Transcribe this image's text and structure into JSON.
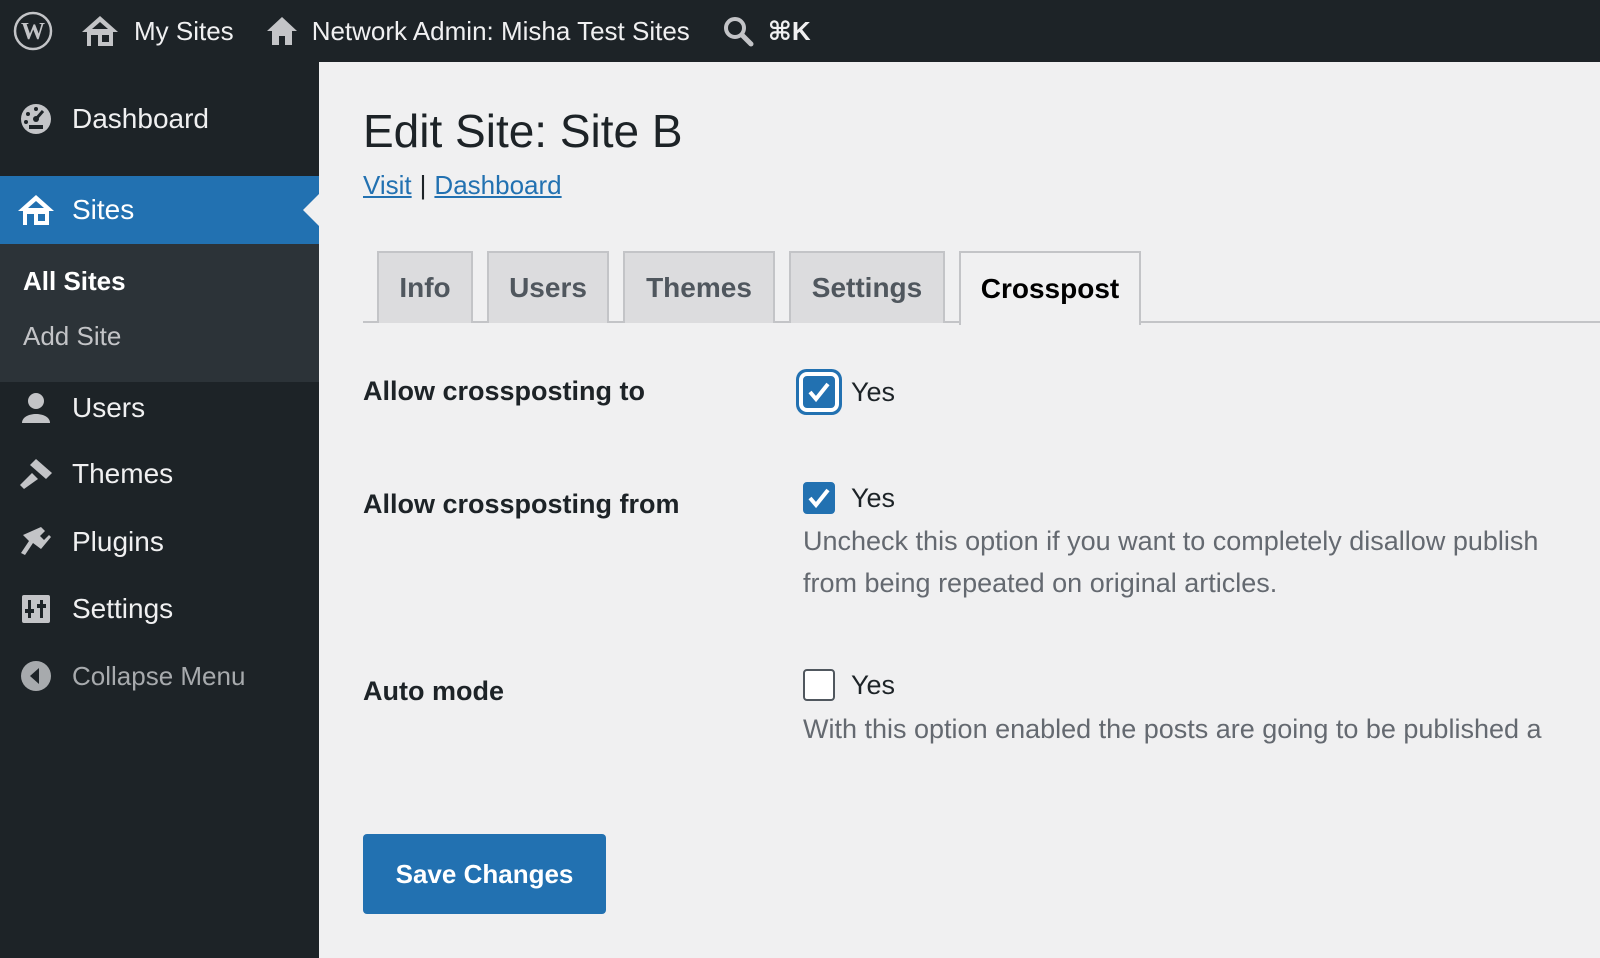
{
  "adminbar": {
    "my_sites": "My Sites",
    "network_admin": "Network Admin: Misha Test Sites",
    "shortcut": "⌘K"
  },
  "sidebar": {
    "dashboard": "Dashboard",
    "sites": "Sites",
    "submenu": {
      "all_sites": "All Sites",
      "add_site": "Add Site"
    },
    "users": "Users",
    "themes": "Themes",
    "plugins": "Plugins",
    "settings": "Settings",
    "collapse": "Collapse Menu"
  },
  "page": {
    "title": "Edit Site: Site B",
    "links": {
      "visit": "Visit",
      "separator": "|",
      "dashboard": "Dashboard"
    },
    "tabs": [
      {
        "label": "Info",
        "active": false
      },
      {
        "label": "Users",
        "active": false
      },
      {
        "label": "Themes",
        "active": false
      },
      {
        "label": "Settings",
        "active": false
      },
      {
        "label": "Crosspost",
        "active": true
      }
    ],
    "fields": [
      {
        "label": "Allow crossposting to",
        "option": "Yes",
        "checked": true
      },
      {
        "label": "Allow crossposting from",
        "option": "Yes",
        "checked": true,
        "description": [
          "Uncheck this option if you want to completely disallow publish",
          "from being repeated on original articles."
        ]
      },
      {
        "label": "Auto mode",
        "option": "Yes",
        "checked": false,
        "description": [
          "With this option enabled the posts are going to be published a"
        ]
      }
    ],
    "save_label": "Save Changes"
  },
  "colors": {
    "adminbar_bg": "#1d2327",
    "accent": "#2271b1",
    "content_bg": "#f0f0f1",
    "submenu_bg": "#2c3338"
  },
  "icons": {
    "wp": "wordpress-logo-icon",
    "my_sites": "my-sites-icon",
    "home": "home-icon",
    "search": "search-icon",
    "dashboard": "dashboard-icon",
    "sites": "sites-icon",
    "users": "users-icon",
    "themes": "themes-icon",
    "plugins": "plugins-icon",
    "settings": "settings-icon",
    "collapse": "collapse-icon"
  }
}
